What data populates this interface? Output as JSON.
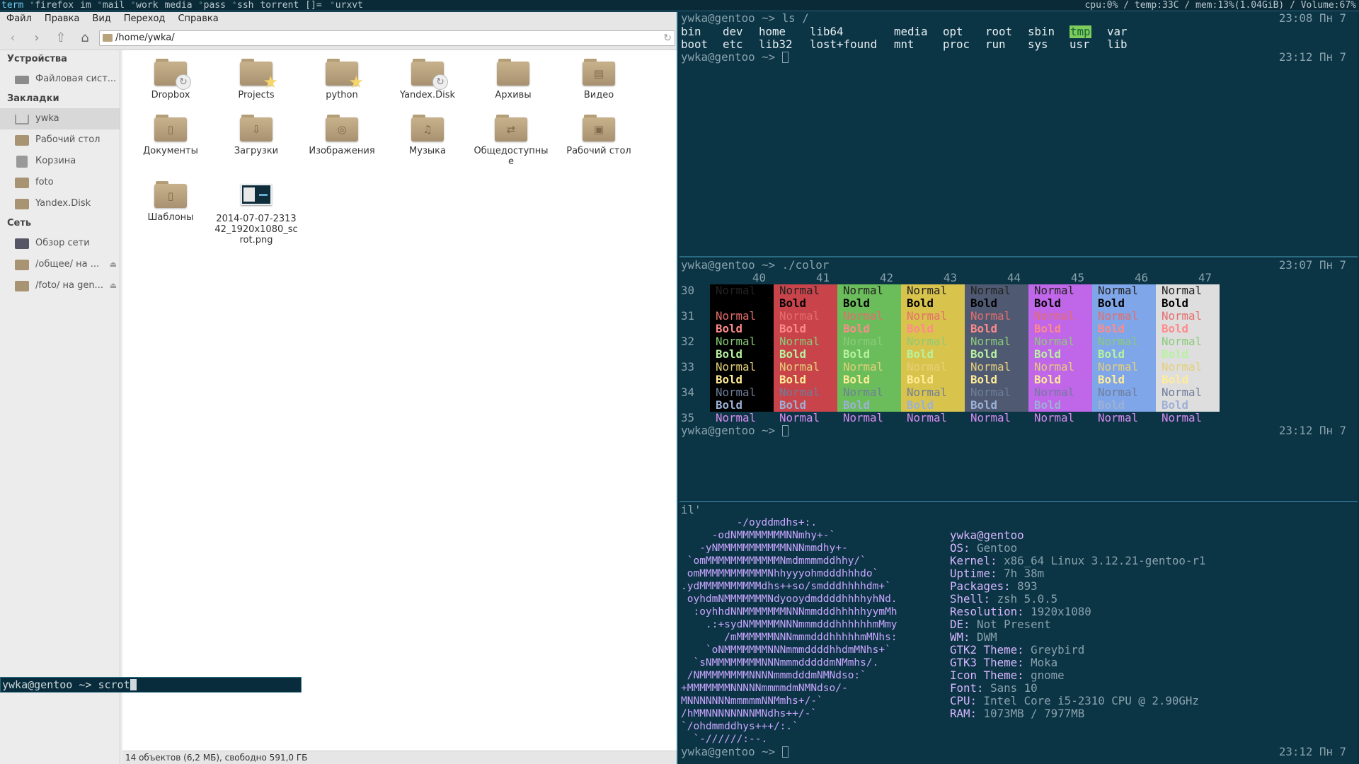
{
  "topbar": {
    "tags": [
      "term",
      "firefox",
      "im",
      "mail",
      "work",
      "media",
      "pass",
      "ssh",
      "torrent"
    ],
    "layout": "[]=",
    "window_title": "urxvt",
    "status": "cpu:0% / temp:33C / mem:13%(1.04GiB) / Volume:67%"
  },
  "fm": {
    "menu": [
      "Файл",
      "Правка",
      "Вид",
      "Переход",
      "Справка"
    ],
    "location": "/home/ywka/",
    "sidebar": {
      "devices_header": "Устройства",
      "devices": [
        {
          "label": "Файловая сист...",
          "icon": "drive-icon"
        }
      ],
      "bookmarks_header": "Закладки",
      "bookmarks": [
        {
          "label": "ywka",
          "icon": "home-icon"
        },
        {
          "label": "Рабочий стол",
          "icon": "desktop-folder-icon"
        },
        {
          "label": "Корзина",
          "icon": "trash-icon"
        },
        {
          "label": "foto",
          "icon": "folder-icon"
        },
        {
          "label": "Yandex.Disk",
          "icon": "sync-folder-icon"
        }
      ],
      "network_header": "Сеть",
      "network": [
        {
          "label": "Обзор сети",
          "icon": "network-icon"
        },
        {
          "label": "/общее/ на ...",
          "icon": "network-folder-icon"
        },
        {
          "label": "/foto/ на gen...",
          "icon": "network-folder-icon"
        }
      ]
    },
    "files": [
      {
        "name": "Dropbox",
        "badge": "sync"
      },
      {
        "name": "Projects",
        "badge": "star"
      },
      {
        "name": "python",
        "badge": "star"
      },
      {
        "name": "Yandex.Disk",
        "badge": "sync"
      },
      {
        "name": "Архивы",
        "badge": ""
      },
      {
        "name": "Видео",
        "emblem": "▤"
      },
      {
        "name": "Документы",
        "emblem": "▯"
      },
      {
        "name": "Загрузки",
        "emblem": "⇩"
      },
      {
        "name": "Изображения",
        "emblem": "◎"
      },
      {
        "name": "Музыка",
        "emblem": "♫"
      },
      {
        "name": "Общедоступные",
        "emblem": "⇄"
      },
      {
        "name": "Рабочий стол",
        "emblem": "▣"
      },
      {
        "name": "Шаблоны",
        "emblem": "▯"
      },
      {
        "name": "2014-07-07-231342_1920x1080_scrot.png",
        "thumbnail": true
      }
    ],
    "status": "14 объектов (6,2 МБ), свободно 591,0 ГБ"
  },
  "cmd": {
    "prompt": "ywka@gentoo ~> ",
    "text": "scrot"
  },
  "term1": {
    "prompt1": "ywka@gentoo ~> ls /",
    "time1": "23:08 Пн 7",
    "ls_row1": [
      "bin",
      "dev",
      "home",
      "lib64",
      "media",
      "opt",
      "root",
      "sbin",
      "tmp",
      "var"
    ],
    "ls_row2": [
      "boot",
      "etc",
      "lib32",
      "lost+found",
      "mnt",
      "proc",
      "run",
      "sys",
      "usr",
      "lib"
    ],
    "prompt2": "ywka@gentoo ~> ",
    "time2": "23:12 Пн 7"
  },
  "term2": {
    "prompt1": "ywka@gentoo ~> ./color",
    "time1": "23:07 Пн 7",
    "headers": [
      "40",
      "41",
      "42",
      "43",
      "44",
      "45",
      "46",
      "47"
    ],
    "rows": [
      "30",
      "31",
      "32",
      "33",
      "34",
      "35"
    ],
    "normal": "Normal",
    "bold": "Bold",
    "bg_colors": [
      "#000000",
      "#c8444a",
      "#6bbd5b",
      "#d8c44c",
      "#4f5a72",
      "#c066e8",
      "#7fa6e8",
      "#dedede"
    ],
    "fg_normal": [
      "#c8c8c8",
      "#e56d6d",
      "#8acb79",
      "#e5cf78",
      "#6f7d9a",
      "#d98cf0",
      "#8fb4ee",
      "#e5e5e5"
    ],
    "fg_bold": [
      "#ffffff",
      "#ff8a8a",
      "#b7f29f",
      "#ffec97",
      "#9db0d6",
      "#f1b6ff",
      "#b7d0ff",
      "#ffffff"
    ],
    "prompt2": "ywka@gentoo ~> ",
    "time2": "23:12 Пн 7"
  },
  "term3": {
    "top": "il'",
    "art": [
      "         -/oyddmdhs+:.",
      "     -odNMMMMMMMMNNmhy+-`",
      "   -yNMMMMMMMMMMMNNNmmdhy+-",
      " `omMMMMMMMMMMMMNmdmmmmddhhy/`",
      " omMMMMMMMMMMMNhhyyyohmdddhhhdo`",
      ".ydMMMMMMMMMMdhs++so/smdddhhhhdm+`",
      " oyhdmNMMMMMMMNdyooydmddddhhhhyhNd.",
      "  :oyhhdNNMMMMMMMNNNmmdddhhhhhyymMh",
      "    .:+sydNMMMMMNNNmmmdddhhhhhhmMmy",
      "       /mMMMMMMNNNmmmdddhhhhhmMNhs:",
      "    `oNMMMMMMMNNNmmmddddhhdmMNhs+`",
      "  `sNMMMMMMMMNNNmmmdddddmNMmhs/.",
      " /NMMMMMMMMNNNNmmmdddmNMNdso:`",
      "+MMMMMMMNNNNNmmmmdmNMNdso/-",
      "MNNNNNNNmmmmmNNMmhs+/-`",
      "/hMMNNNNNNNNMNdhs++/-`",
      "`/ohdmmddhys+++/:.`",
      "  `-//////:--."
    ],
    "info": [
      {
        "key": "ywka@gentoo",
        "value": ""
      },
      {
        "key": "OS:",
        "value": "Gentoo"
      },
      {
        "key": "Kernel:",
        "value": "x86_64 Linux 3.12.21-gentoo-r1"
      },
      {
        "key": "Uptime:",
        "value": "7h 38m"
      },
      {
        "key": "Packages:",
        "value": "893"
      },
      {
        "key": "Shell:",
        "value": "zsh 5.0.5"
      },
      {
        "key": "Resolution:",
        "value": "1920x1080"
      },
      {
        "key": "DE:",
        "value": "Not Present"
      },
      {
        "key": "WM:",
        "value": "DWM"
      },
      {
        "key": "GTK2 Theme:",
        "value": "Greybird"
      },
      {
        "key": "GTK3 Theme:",
        "value": "Moka"
      },
      {
        "key": "Icon Theme:",
        "value": "gnome"
      },
      {
        "key": "Font:",
        "value": "Sans 10"
      },
      {
        "key": "CPU:",
        "value": "Intel Core i5-2310 CPU @ 2.90GHz"
      },
      {
        "key": "RAM:",
        "value": "1073MB / 7977MB"
      }
    ],
    "prompt": "ywka@gentoo ~> ",
    "time": "23:12 Пн 7"
  }
}
